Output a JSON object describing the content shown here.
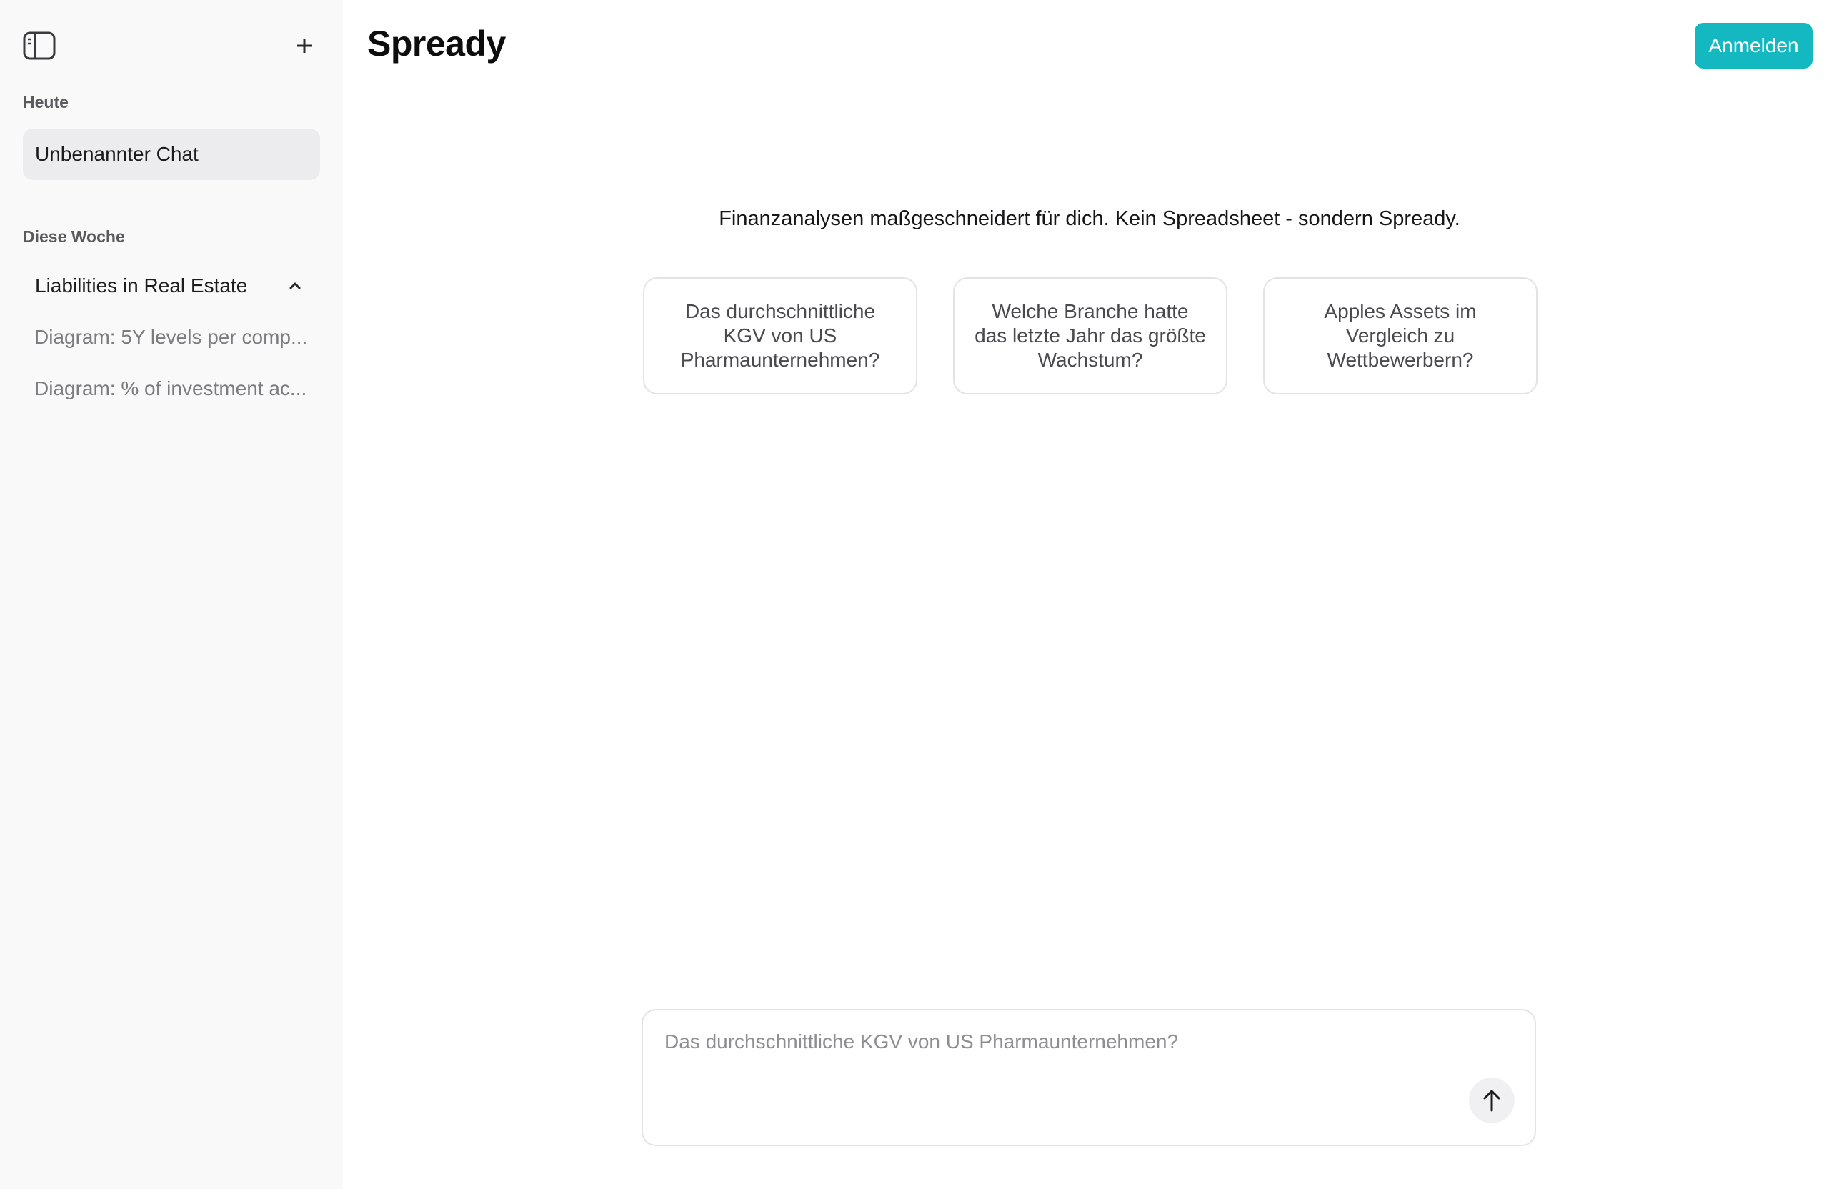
{
  "app": {
    "brand": "Spready"
  },
  "header": {
    "login_label": "Anmelden"
  },
  "sidebar": {
    "toggle_icon": "sidebar-toggle-icon",
    "new_chat_icon": "plus-icon",
    "sections": [
      {
        "label": "Heute"
      },
      {
        "label": "Diese Woche"
      }
    ],
    "today_items": [
      {
        "label": "Unbenannter Chat",
        "active": true
      }
    ],
    "week_items": [
      {
        "label": "Liabilities in Real Estate",
        "expanded": true,
        "children": [
          {
            "label": "Diagram: 5Y levels per comp..."
          },
          {
            "label": "Diagram: % of investment ac..."
          }
        ]
      }
    ]
  },
  "main": {
    "tagline": "Finanzanalysen maßgeschneidert für dich. Kein Spreadsheet - sondern Spready.",
    "suggestions": [
      {
        "label": "Das durchschnittliche KGV von US Pharmaunternehmen?"
      },
      {
        "label": "Welche Branche hatte das letzte Jahr das größte Wachstum?"
      },
      {
        "label": "Apples Assets im Vergleich zu Wettbewerbern?"
      }
    ]
  },
  "composer": {
    "placeholder": "Das durchschnittliche KGV von US Pharmaunternehmen?",
    "value": "",
    "send_icon": "arrow-up-icon"
  },
  "colors": {
    "accent": "#13b8c1",
    "sidebar_bg": "#f9f9f9",
    "active_item_bg": "#ececee"
  }
}
